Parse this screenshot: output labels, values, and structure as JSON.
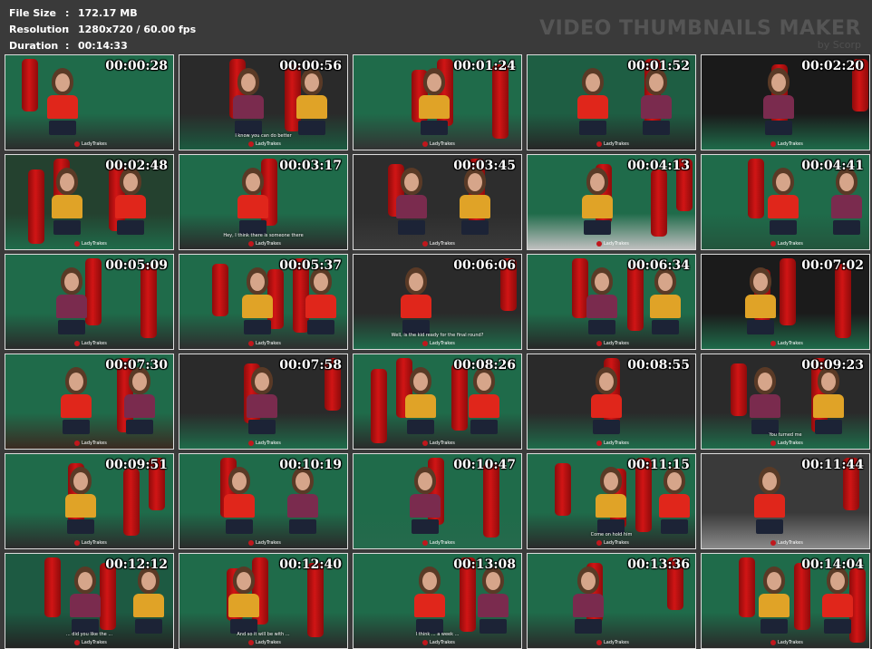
{
  "info": {
    "file_size_label": "File Size",
    "file_size_value": "172.17 MB",
    "resolution_label": "Resolution",
    "resolution_value": "1280x720 / 60.00 fps",
    "duration_label": "Duration",
    "duration_value": "00:14:33",
    "separator": ":"
  },
  "watermark": {
    "title": "VIDEO THUMBNAILS MAKER",
    "byline": "by Scorp"
  },
  "logo_text": "LadyTrakes",
  "thumbnails": [
    {
      "time": "00:00:28",
      "subtitle": ""
    },
    {
      "time": "00:00:56",
      "subtitle": "I know you can do better"
    },
    {
      "time": "00:01:24",
      "subtitle": ""
    },
    {
      "time": "00:01:52",
      "subtitle": ""
    },
    {
      "time": "00:02:20",
      "subtitle": ""
    },
    {
      "time": "00:02:48",
      "subtitle": ""
    },
    {
      "time": "00:03:17",
      "subtitle": "Hey, I think there is someone there"
    },
    {
      "time": "00:03:45",
      "subtitle": ""
    },
    {
      "time": "00:04:13",
      "subtitle": ""
    },
    {
      "time": "00:04:41",
      "subtitle": ""
    },
    {
      "time": "00:05:09",
      "subtitle": ""
    },
    {
      "time": "00:05:37",
      "subtitle": ""
    },
    {
      "time": "00:06:06",
      "subtitle": "Well, is the kid ready for the final round?"
    },
    {
      "time": "00:06:34",
      "subtitle": ""
    },
    {
      "time": "00:07:02",
      "subtitle": ""
    },
    {
      "time": "00:07:30",
      "subtitle": ""
    },
    {
      "time": "00:07:58",
      "subtitle": ""
    },
    {
      "time": "00:08:26",
      "subtitle": ""
    },
    {
      "time": "00:08:55",
      "subtitle": ""
    },
    {
      "time": "00:09:23",
      "subtitle": "You turned me"
    },
    {
      "time": "00:09:51",
      "subtitle": ""
    },
    {
      "time": "00:10:19",
      "subtitle": ""
    },
    {
      "time": "00:10:47",
      "subtitle": ""
    },
    {
      "time": "00:11:15",
      "subtitle": "Come on hold him"
    },
    {
      "time": "00:11:44",
      "subtitle": ""
    },
    {
      "time": "00:12:12",
      "subtitle": "... did you like the ..."
    },
    {
      "time": "00:12:40",
      "subtitle": "And so it will be with ..."
    },
    {
      "time": "00:13:08",
      "subtitle": "I think ... a week ..."
    },
    {
      "time": "00:13:36",
      "subtitle": ""
    },
    {
      "time": "00:14:04",
      "subtitle": ""
    }
  ],
  "colors": {
    "background": "#3a3a3a",
    "border": "#dcdcdc",
    "wall_green": "#1f6b4a",
    "bag_red": "#d11515",
    "top_red": "#e0261b",
    "top_plum": "#7a2b4e",
    "shirt_yellow": "#e0a327"
  }
}
